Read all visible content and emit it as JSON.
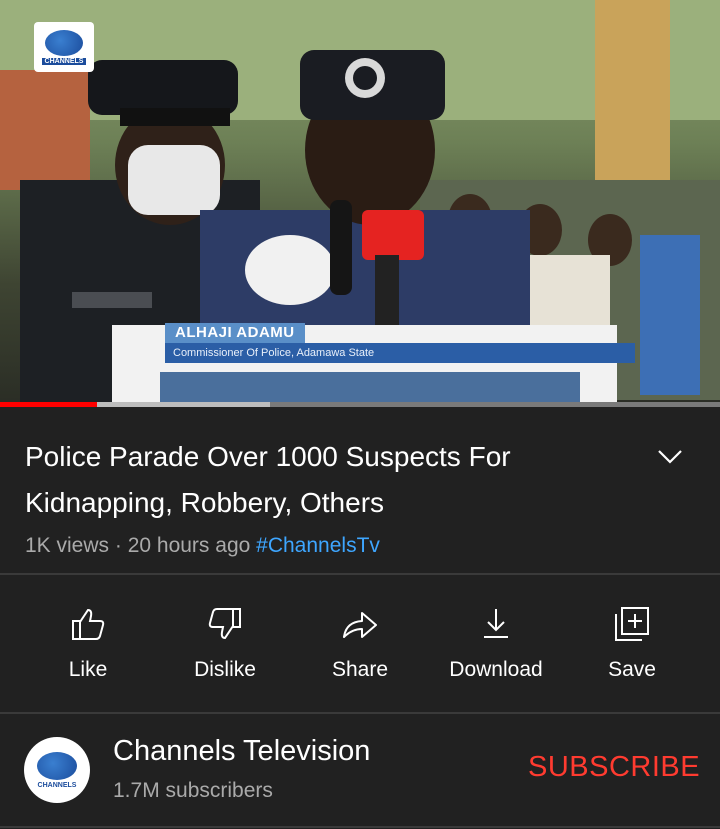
{
  "video": {
    "channel_logo_text": "CHANNELS",
    "lower_third": {
      "name": "ALHAJI ADAMU",
      "role": "Commissioner Of Police, Adamawa State"
    },
    "progress": {
      "played_fraction": 0.135,
      "buffered_fraction": 0.375
    }
  },
  "details": {
    "title": "Police Parade Over 1000 Suspects For Kidnapping, Robbery, Others",
    "views": "1K views",
    "time_ago": "20 hours ago",
    "hashtag": "#ChannelsTv",
    "expand_icon": "chevron-down-icon"
  },
  "actions": [
    {
      "label": "Like",
      "icon": "thumbs-up-icon"
    },
    {
      "label": "Dislike",
      "icon": "thumbs-down-icon"
    },
    {
      "label": "Share",
      "icon": "share-arrow-icon"
    },
    {
      "label": "Download",
      "icon": "download-icon"
    },
    {
      "label": "Save",
      "icon": "add-to-playlist-icon"
    }
  ],
  "channel": {
    "name": "Channels Television",
    "subscribers": "1.7M subscribers",
    "subscribe_label": "SUBSCRIBE",
    "avatar_text": "CHANNELS"
  },
  "colors": {
    "background": "#212121",
    "text_primary": "#ffffff",
    "text_secondary": "#aaaaaa",
    "hashtag": "#3ea6ff",
    "subscribe": "#ff3b30",
    "progress_played": "#ff0000"
  }
}
